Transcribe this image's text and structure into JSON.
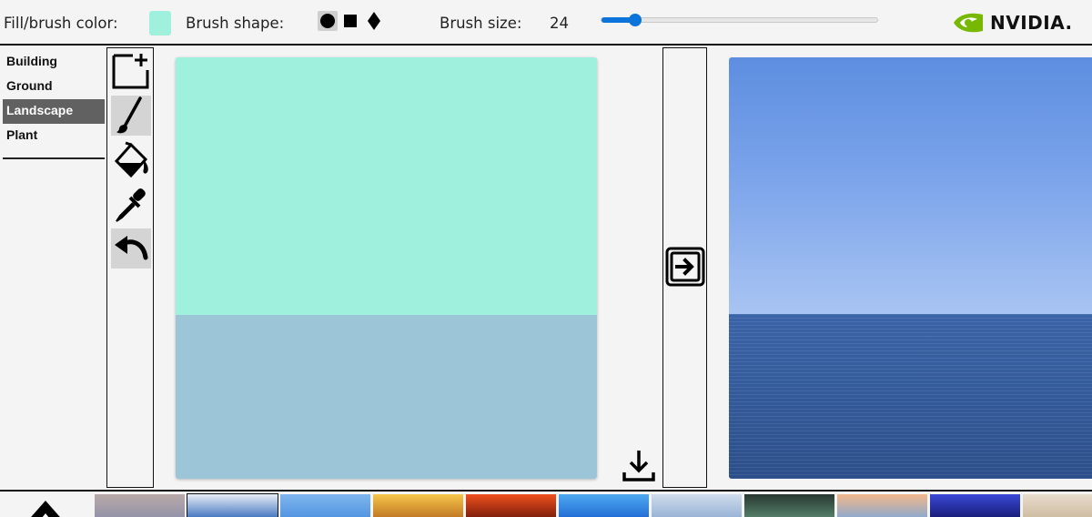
{
  "toolbar": {
    "fill_label": "Fill/brush color:",
    "fill_color": "#9ff0dc",
    "shape_label": "Brush shape:",
    "shapes": [
      {
        "name": "circle",
        "icon": "circle-icon",
        "selected": true
      },
      {
        "name": "square",
        "icon": "square-icon",
        "selected": false
      },
      {
        "name": "diamond",
        "icon": "diamond-icon",
        "selected": false
      }
    ],
    "size_label": "Brush size:",
    "size_value": "24",
    "size_slider_fraction": 0.12,
    "accent_color": "#0a74da"
  },
  "brand": {
    "logo_text": "NVIDIA.",
    "logo_color": "#76b900"
  },
  "categories": [
    {
      "label": "Building",
      "active": false
    },
    {
      "label": "Ground",
      "active": false
    },
    {
      "label": "Landscape",
      "active": true
    },
    {
      "label": "Plant",
      "active": false
    }
  ],
  "tools": [
    {
      "name": "new-canvas",
      "icon": "new-canvas-icon",
      "active": false
    },
    {
      "name": "brush",
      "icon": "brush-icon",
      "active": true
    },
    {
      "name": "fill",
      "icon": "paint-bucket-icon",
      "active": false
    },
    {
      "name": "eyedropper",
      "icon": "eyedropper-icon",
      "active": false
    },
    {
      "name": "undo",
      "icon": "undo-icon",
      "active": true
    }
  ],
  "canvas": {
    "top_color": "#9ff0dc",
    "bottom_color": "#9cc5d8"
  },
  "actions": {
    "download_icon": "download-icon",
    "generate_icon": "arrow-right-icon"
  },
  "thumbnails": [
    {
      "colors": [
        "#b9a9a8",
        "#8d8fa8"
      ]
    },
    {
      "colors": [
        "#e8eef6",
        "#2b63b8"
      ]
    },
    {
      "colors": [
        "#7fb6ee",
        "#4b8fe0"
      ]
    },
    {
      "colors": [
        "#f6c64a",
        "#b86b1e"
      ]
    },
    {
      "colors": [
        "#f0501e",
        "#6b1608"
      ]
    },
    {
      "colors": [
        "#4fa9f0",
        "#1a63d0"
      ]
    },
    {
      "colors": [
        "#cfdcec",
        "#8facd2"
      ]
    },
    {
      "colors": [
        "#283830",
        "#5c8c74"
      ]
    },
    {
      "colors": [
        "#f2b88a",
        "#7ea6d8"
      ]
    },
    {
      "colors": [
        "#3a48d6",
        "#13166a"
      ]
    },
    {
      "colors": [
        "#e8dccb",
        "#c9b79c"
      ]
    }
  ]
}
